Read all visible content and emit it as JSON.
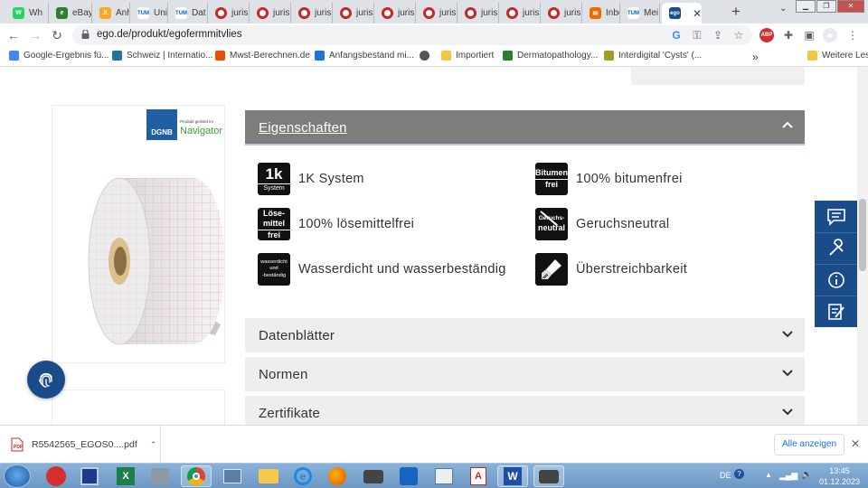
{
  "tabs": [
    {
      "label": "Wh",
      "color": "#25d366",
      "glyph": "W"
    },
    {
      "label": "eBay",
      "color": "#2e7d32",
      "glyph": "e"
    },
    {
      "label": "Anh",
      "color": "#f9a825",
      "glyph": "X"
    },
    {
      "label": "Uni",
      "color": "#0065bd",
      "glyph": "TUM"
    },
    {
      "label": "Dat",
      "color": "#0065bd",
      "glyph": "TUM"
    },
    {
      "label": "juris",
      "color": "#c62828",
      "glyph": "o"
    },
    {
      "label": "juris",
      "color": "#c62828",
      "glyph": "o"
    },
    {
      "label": "juris",
      "color": "#c62828",
      "glyph": "o"
    },
    {
      "label": "juris",
      "color": "#c62828",
      "glyph": "o"
    },
    {
      "label": "juris",
      "color": "#c62828",
      "glyph": "o"
    },
    {
      "label": "juris",
      "color": "#c62828",
      "glyph": "o"
    },
    {
      "label": "juris",
      "color": "#c62828",
      "glyph": "o"
    },
    {
      "label": "juris",
      "color": "#c62828",
      "glyph": "o"
    },
    {
      "label": "juris",
      "color": "#c62828",
      "glyph": "o"
    },
    {
      "label": "Inbc",
      "color": "#ef6c00",
      "glyph": "✉"
    },
    {
      "label": "Mei",
      "color": "#0065bd",
      "glyph": "TUM"
    }
  ],
  "active_tab": {
    "glyph": "ego"
  },
  "address": {
    "url": "ego.de/produkt/egofermmitvlies"
  },
  "bookmarks": [
    {
      "label": "Google-Ergebnis fü...",
      "color": "#4285f4"
    },
    {
      "label": "Schweiz | Internatio...",
      "color": "#21759b"
    },
    {
      "label": "Mwst-Berechnen.de",
      "color": "#e65100"
    },
    {
      "label": "Anfangsbestand mi...",
      "color": "#1976d2"
    },
    {
      "label": "",
      "color": "#555"
    },
    {
      "label": "Importiert",
      "color": "#f4c542"
    },
    {
      "label": "Dermatopathology...",
      "color": "#2e7d32"
    },
    {
      "label": "Interdigital 'Cysts' (...",
      "color": "#9e9d24"
    }
  ],
  "bookmarks_overflow": "»",
  "bookmarks_other": "Weitere Lesezeichen",
  "product": {
    "badge_brand": "DGNB",
    "badge_line1": "Produkt gelistet im",
    "badge_line2": "Navigator"
  },
  "accordion_open": {
    "label": "Eigenschaften"
  },
  "features": [
    {
      "icon_top": "1k",
      "icon_bottom": "System",
      "text": "1K System",
      "icon": "1k-system-icon"
    },
    {
      "icon_top": "Bitumen",
      "icon_bottom": "frei",
      "text": "100% bitumenfrei",
      "icon": "bitumen-free-icon"
    },
    {
      "icon_top": "Löse-",
      "icon_mid": "mittel",
      "icon_bottom": "frei",
      "text": "100% lösemittelfrei",
      "icon": "solvent-free-icon"
    },
    {
      "icon_top": "Geruchs-",
      "icon_bottom": "neutral",
      "text": "Geruchsneutral",
      "icon": "odor-neutral-icon"
    },
    {
      "icon_top": "wasserdicht",
      "icon_mid": "und",
      "icon_bottom": "-beständig",
      "text": "Wasserdicht und wasserbeständig",
      "icon": "waterproof-icon"
    },
    {
      "icon_top": "",
      "icon_bottom": "",
      "text": "Überstreichbarkeit",
      "icon": "paintbrush-icon"
    }
  ],
  "accordions": [
    {
      "label": "Datenblätter"
    },
    {
      "label": "Normen"
    },
    {
      "label": "Zertifikate"
    }
  ],
  "download": {
    "file": "R5542565_EGOS0....pdf",
    "show_all": "Alle anzeigen"
  },
  "tray": {
    "lang": "DE",
    "time": "13:45",
    "date": "01.12.2023"
  },
  "colors": {
    "brand_blue": "#1a4c8a",
    "open_header": "#7d7d7d",
    "accordion_bg": "#eeeeee"
  }
}
